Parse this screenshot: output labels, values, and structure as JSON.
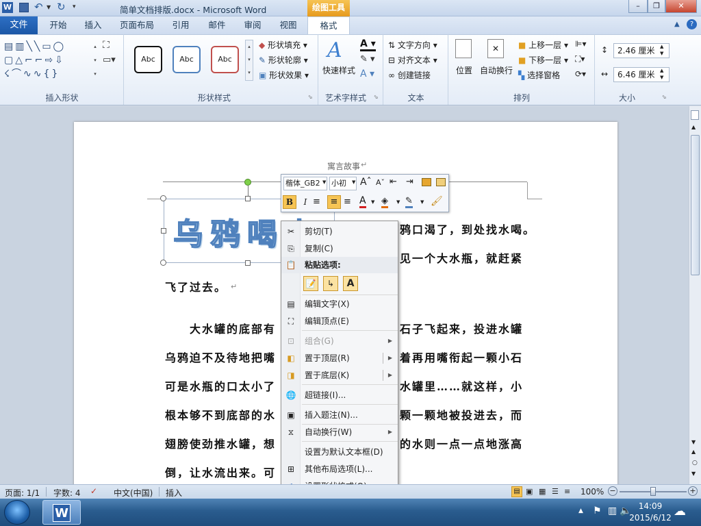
{
  "window": {
    "title": "简单文档排版.docx - Microsoft Word",
    "context_tab_group": "绘图工具"
  },
  "quick_access": {
    "save_icon": "save-icon",
    "undo_icon": "undo-icon",
    "redo_icon": "redo-icon"
  },
  "tabs": {
    "file": "文件",
    "items": [
      "开始",
      "插入",
      "页面布局",
      "引用",
      "邮件",
      "审阅",
      "视图"
    ],
    "format": "格式"
  },
  "ribbon": {
    "insert_shapes": {
      "label": "插入形状"
    },
    "shape_styles": {
      "label": "形状样式",
      "abc": "Abc",
      "fill": "形状填充",
      "outline": "形状轮廓",
      "effects": "形状效果"
    },
    "wordart": {
      "label": "艺术字样式",
      "quick_styles": "快速样式"
    },
    "text": {
      "label": "文本",
      "direction": "文字方向",
      "align": "对齐文本",
      "link": "创建链接"
    },
    "arrange": {
      "label": "排列",
      "position": "位置",
      "wrap": "自动换行",
      "bring_forward": "上移一层",
      "send_backward": "下移一层",
      "selection_pane": "选择窗格"
    },
    "size": {
      "label": "大小",
      "height": "2.46 厘米",
      "width": "6.46 厘米"
    }
  },
  "document": {
    "header_title": "寓言故事",
    "wordart": "乌鸦喝水",
    "lines": [
      "鸦口渴了，到处找水喝。",
      "见一个大水瓶，就赶紧",
      "飞了过去。",
      "大水罐的底部有",
      "石子飞起来，投进水罐",
      "乌鸦迫不及待地把嘴",
      "着再用嘴衔起一颗小石",
      "可是水瓶的口太小了",
      "水罐里……就这样，小",
      "根本够不到底部的水",
      "颗一颗地被投进去，而",
      "翅膀使劲推水罐，想",
      "的水则一点一点地涨高",
      "倒，让水流出来。可"
    ]
  },
  "mini_toolbar": {
    "font": "楷体_GB2",
    "size": "小初",
    "bold": "B",
    "italic": "I"
  },
  "context_menu": {
    "cut": "剪切(T)",
    "copy": "复制(C)",
    "paste_options": "粘贴选项:",
    "edit_text": "编辑文字(X)",
    "edit_points": "编辑顶点(E)",
    "group": "组合(G)",
    "bring_to_front": "置于顶层(R)",
    "send_to_back": "置于底层(K)",
    "hyperlink": "超链接(I)...",
    "insert_caption": "插入题注(N)...",
    "wrap_text": "自动换行(W)",
    "set_default": "设置为默认文本框(D)",
    "more_layout": "其他布局选项(L)...",
    "format_shape": "设置形状格式(O)..."
  },
  "status": {
    "page": "页面: 1/1",
    "words": "字数: 4",
    "language": "中文(中国)",
    "mode": "插入",
    "zoom": "100%"
  },
  "taskbar": {
    "time": "14:09",
    "date": "2015/6/12"
  }
}
